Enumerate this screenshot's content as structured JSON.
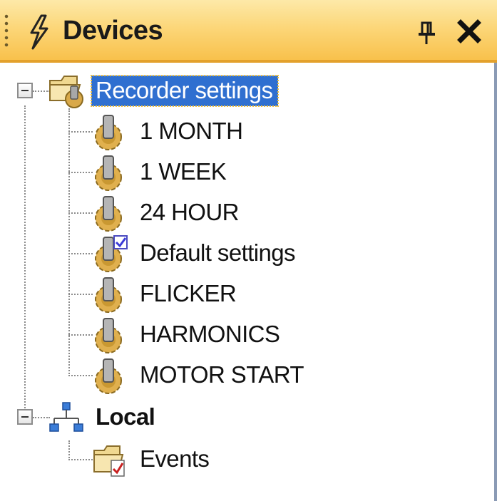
{
  "panel": {
    "title": "Devices",
    "title_icon": "lightning-icon",
    "pin_icon": "pin-icon",
    "close_icon": "close-icon"
  },
  "tree": {
    "recorder_settings": {
      "label": "Recorder settings",
      "icon": "folder-gear-icon",
      "expanded": true,
      "selected": true,
      "children": [
        {
          "label": "1 MONTH",
          "icon": "gear-plug-icon"
        },
        {
          "label": "1 WEEK",
          "icon": "gear-plug-icon"
        },
        {
          "label": "24 HOUR",
          "icon": "gear-plug-icon"
        },
        {
          "label": "Default settings",
          "icon": "gear-plug-checked-icon"
        },
        {
          "label": "FLICKER",
          "icon": "gear-plug-icon"
        },
        {
          "label": "HARMONICS",
          "icon": "gear-plug-icon"
        },
        {
          "label": "MOTOR START",
          "icon": "gear-plug-icon"
        }
      ]
    },
    "local": {
      "label": "Local",
      "icon": "network-icon",
      "expanded": true,
      "children": [
        {
          "label": "Events",
          "icon": "folder-events-icon"
        }
      ]
    }
  },
  "colors": {
    "title_gradient_top": "#fde9a8",
    "title_gradient_bottom": "#f8c14c",
    "selection": "#2f6fd0"
  }
}
